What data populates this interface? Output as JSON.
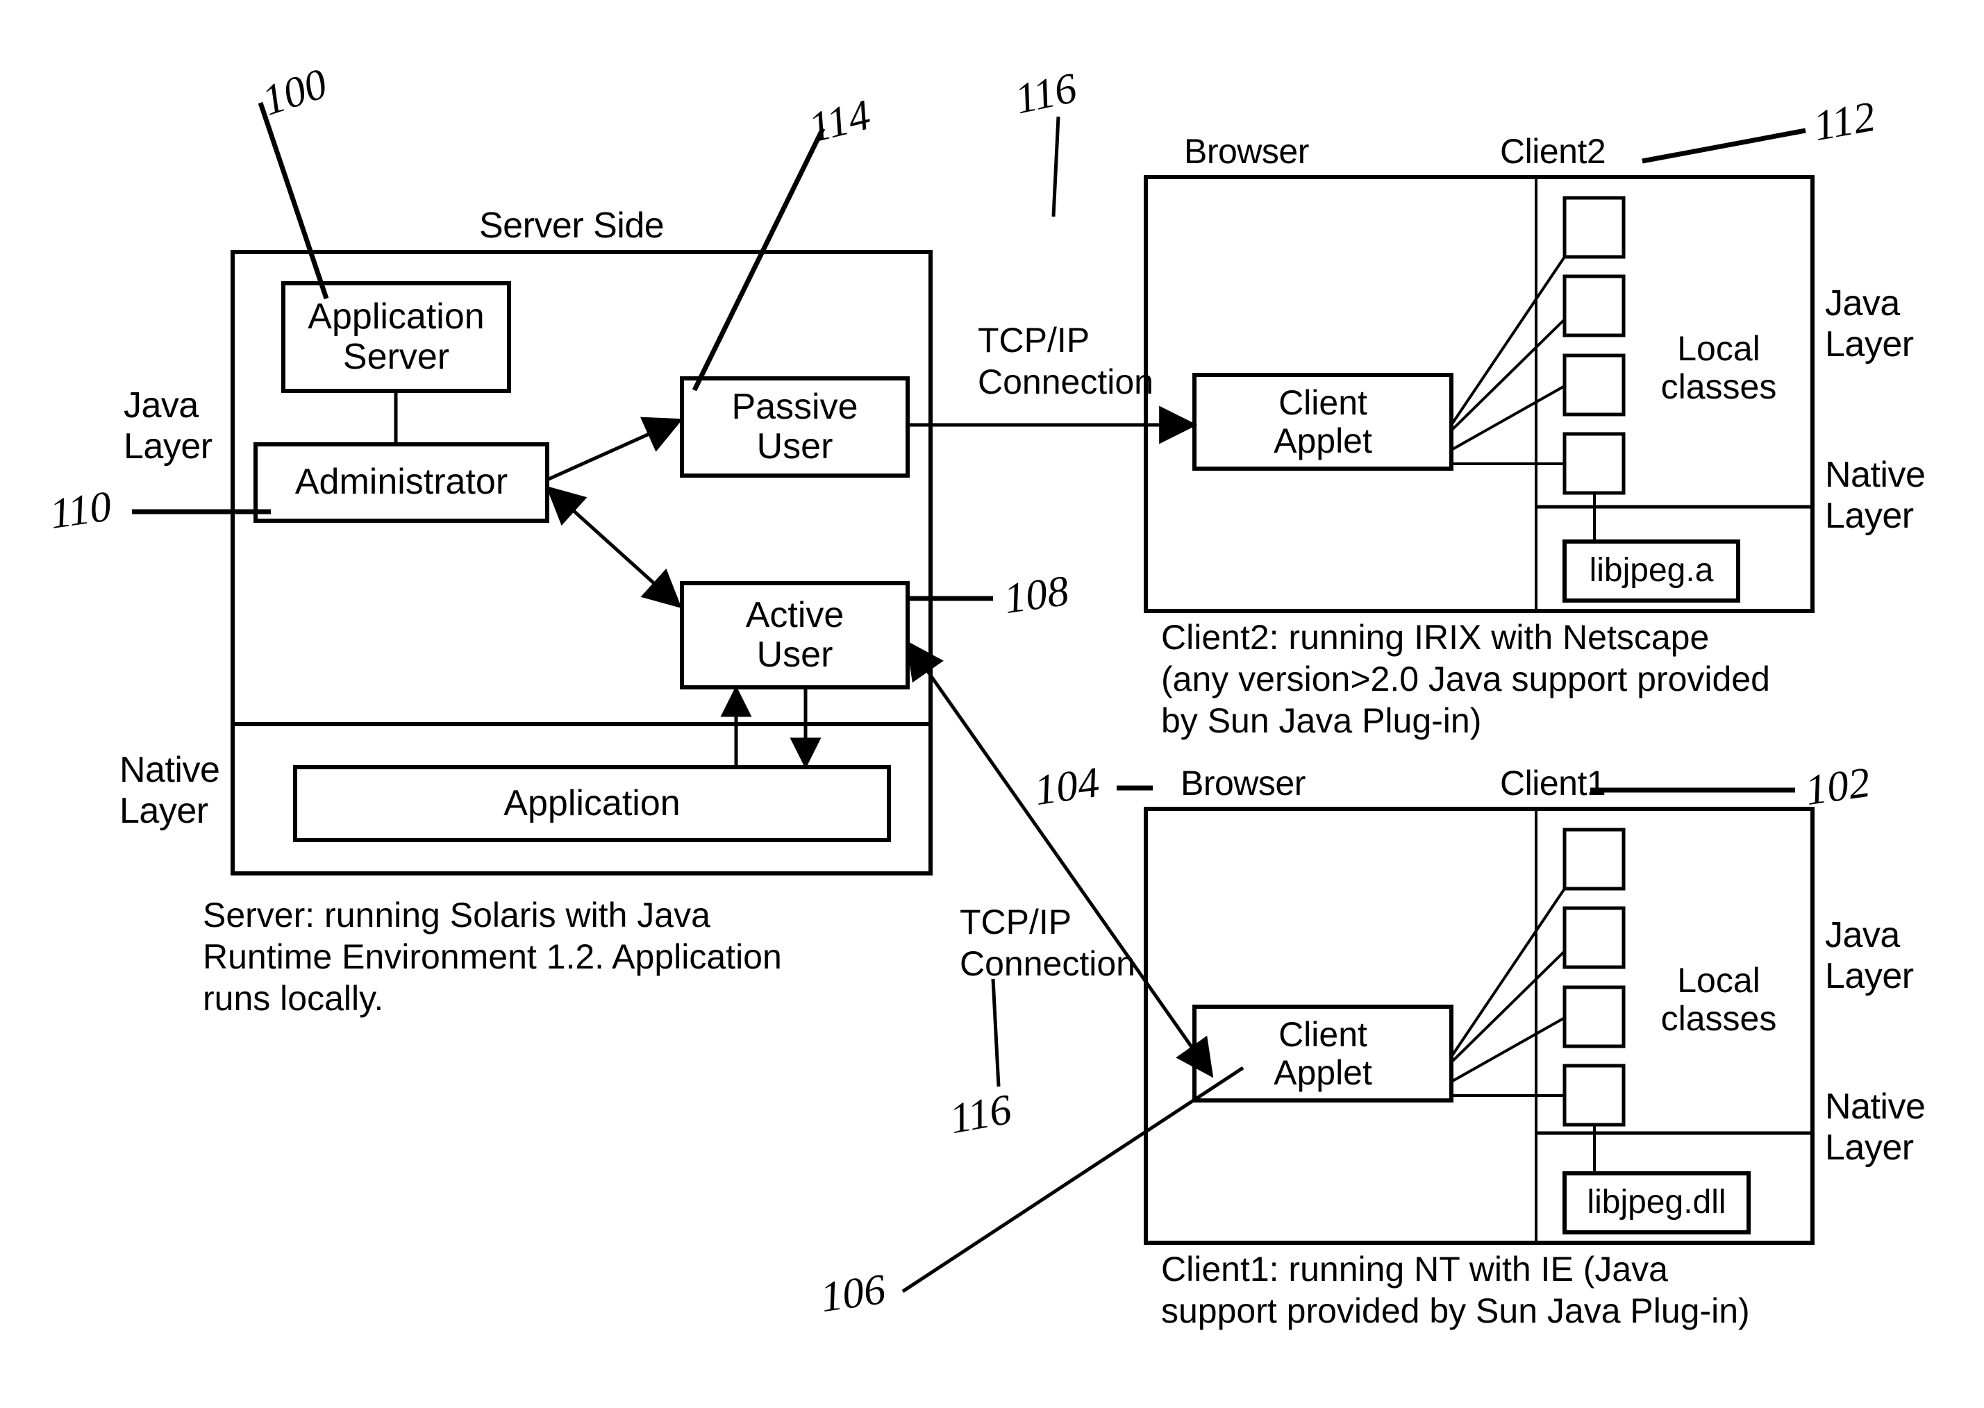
{
  "figure": {
    "title": "Server / Client Java architecture diagram",
    "server_side_label": "Server Side"
  },
  "server": {
    "java_layer_label": "Java\nLayer",
    "native_layer_label": "Native\nLayer",
    "boxes": {
      "application_server": "Application\nServer",
      "administrator": "Administrator",
      "passive_user": "Passive\nUser",
      "active_user": "Active\nUser",
      "application": "Application"
    },
    "caption": "Server: running Solaris with Java\nRuntime Environment 1.2. Application\nruns locally."
  },
  "connections": {
    "top_label": "TCP/IP\nConnection",
    "bottom_label": "TCP/IP\nConnection"
  },
  "client2": {
    "browser_label": "Browser",
    "name_label": "Client2",
    "applet_label": "Client\nApplet",
    "local_classes_label": "Local\nclasses",
    "java_layer_label": "Java\nLayer",
    "native_layer_label": "Native\nLayer",
    "native_lib_label": "libjpeg.a",
    "caption": "Client2: running IRIX with Netscape\n(any version>2.0 Java support provided\nby Sun Java Plug-in)"
  },
  "client1": {
    "browser_label": "Browser",
    "name_label": "Client1",
    "applet_label": "Client\nApplet",
    "local_classes_label": "Local\nclasses",
    "java_layer_label": "Java\nLayer",
    "native_layer_label": "Native\nLayer",
    "native_lib_label": "libjpeg.dll",
    "caption": "Client1: running NT with IE (Java\nsupport provided by Sun Java Plug-in)"
  },
  "reference_numerals": {
    "n100": "100",
    "n102": "102",
    "n104": "104",
    "n106": "106",
    "n108": "108",
    "n110": "110",
    "n112": "112",
    "n114": "114",
    "n116_top": "116",
    "n116_bottom": "116"
  },
  "colors": {
    "ink": "#000000",
    "paper": "#ffffff"
  }
}
